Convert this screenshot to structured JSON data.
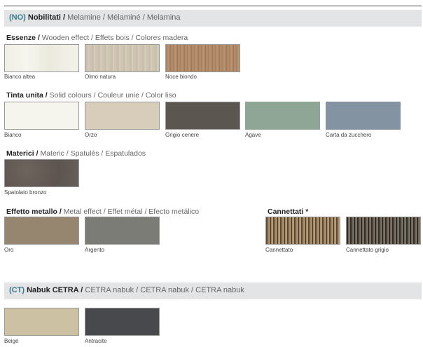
{
  "header": {
    "code": "(NO)",
    "title": "Nobilitati /",
    "subtitle": "Melamine / Mélaminé / Melamina"
  },
  "sections": {
    "essenze": {
      "title": "Essenze /",
      "subtitle": "Wooden effect / Effets bois / Colores madera",
      "swatches": [
        {
          "label": "Bianco altea",
          "color": "#f1f0e8"
        },
        {
          "label": "Olmo natura",
          "color": "#cfc4b2"
        },
        {
          "label": "Noce biondo",
          "color": "#ad8767"
        }
      ]
    },
    "tinta_unita": {
      "title": "Tinta unita /",
      "subtitle": "Solid colours / Couleur unie / Color liso",
      "swatches": [
        {
          "label": "Bianco",
          "color": "#f5f5ee"
        },
        {
          "label": "Orzo",
          "color": "#d8cdbb"
        },
        {
          "label": "Grigio cenere",
          "color": "#5c5651"
        },
        {
          "label": "Agave",
          "color": "#8fa697"
        },
        {
          "label": "Carta da zucchero",
          "color": "#8393a2"
        }
      ]
    },
    "materici": {
      "title": "Materici /",
      "subtitle": "Materic / Spatulés / Espatulados",
      "swatches": [
        {
          "label": "Spatolato bronzo",
          "color": "#645a55"
        }
      ]
    },
    "effetto_metallo": {
      "title": "Effetto metallo /",
      "subtitle": "Metal effect / Effet métal / Efecto metálico",
      "swatches": [
        {
          "label": "Oro",
          "color": "#968670"
        },
        {
          "label": "Argento",
          "color": "#7b7c76"
        }
      ]
    },
    "cannettati": {
      "title": "Cannettati *",
      "swatches": [
        {
          "label": "Cannettato",
          "color": "#8a7254"
        },
        {
          "label": "Cannettato grigio",
          "color": "#4a443d"
        }
      ]
    }
  },
  "footer_section": {
    "code": "(CT)",
    "title": "Nabuk CETRA /",
    "subtitle": "CETRA nabuk / CETRA nabuk / CETRA nabuk",
    "swatches": [
      {
        "label": "Beige",
        "color": "#cdc1a4"
      },
      {
        "label": "Antracite",
        "color": "#47494c"
      }
    ]
  }
}
